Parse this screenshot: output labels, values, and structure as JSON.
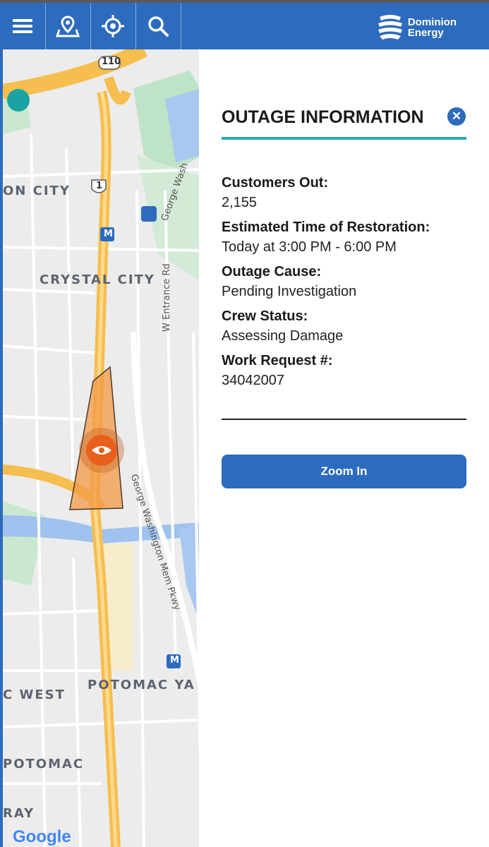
{
  "colors": {
    "brand": "#2c6bbd",
    "accent": "#2aa8b8",
    "outage": "#f39a45"
  },
  "toolbar": {
    "buttons": [
      {
        "icon": "menu-icon"
      },
      {
        "icon": "map-pin-icon"
      },
      {
        "icon": "locate-icon"
      },
      {
        "icon": "search-icon"
      }
    ],
    "brand_line1": "Dominion",
    "brand_line2": "Energy"
  },
  "map": {
    "labels": {
      "arlington_city": "ON CITY",
      "crystal_city": "CRYSTAL CITY",
      "w_entrance": "W Entrance Rd",
      "george_wash_top": "George Wash",
      "gw_parkway": "George Washington Mem Pkwy",
      "potomac_yard": "POTOMAC YA",
      "c_west": "C WEST",
      "potomac": "POTOMAC",
      "ray": "RAY",
      "route_110": "110",
      "route_1": "1",
      "metro": "M",
      "google": "Google"
    }
  },
  "panel": {
    "title": "OUTAGE INFORMATION",
    "fields": [
      {
        "label": "Customers Out:",
        "value": "2,155"
      },
      {
        "label": "Estimated Time of Restoration:",
        "value": "Today at 3:00 PM - 6:00 PM"
      },
      {
        "label": "Outage Cause:",
        "value": "Pending Investigation"
      },
      {
        "label": "Crew Status:",
        "value": "Assessing Damage"
      },
      {
        "label": "Work Request #:",
        "value": "34042007"
      }
    ],
    "zoom_button": "Zoom In"
  }
}
